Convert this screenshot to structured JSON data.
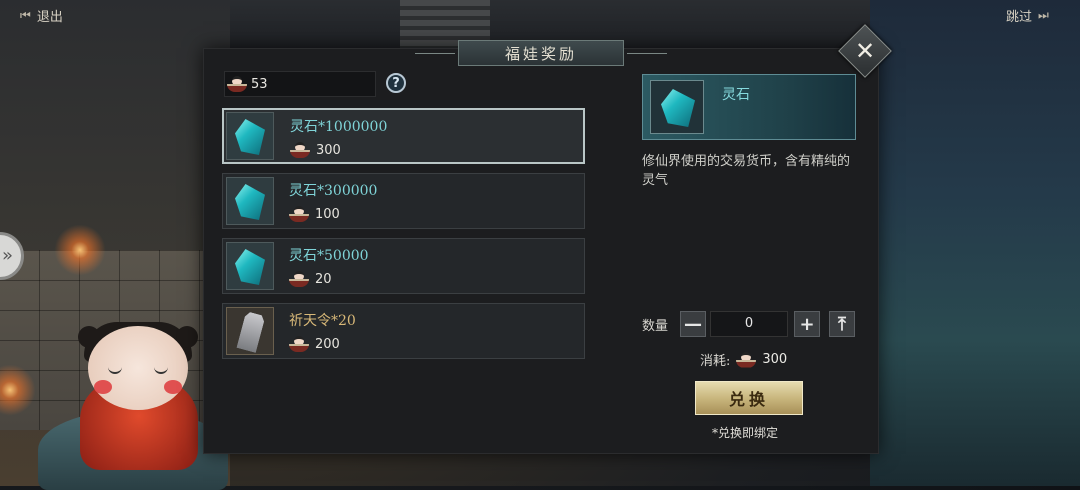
{
  "top_bar": {
    "exit_label": "退出",
    "skip_label": "跳过"
  },
  "panel": {
    "title": "福娃奖励"
  },
  "currency": {
    "amount": "53",
    "icon": "fuwa-doll-icon"
  },
  "items": [
    {
      "name": "灵石*1000000",
      "price": "300",
      "icon": "spirit-stone-icon",
      "selected": true
    },
    {
      "name": "灵石*300000",
      "price": "100",
      "icon": "spirit-stone-icon",
      "selected": false
    },
    {
      "name": "灵石*50000",
      "price": "20",
      "icon": "spirit-stone-icon",
      "selected": false
    },
    {
      "name": "祈天令*20",
      "price": "200",
      "icon": "prayer-token-icon",
      "selected": false
    }
  ],
  "detail": {
    "name": "灵石",
    "description": "修仙界使用的交易货币，含有精纯的灵气",
    "quantity_label": "数量",
    "quantity_value": "0",
    "cost_label": "消耗:",
    "cost_value": "300",
    "exchange_label": "兑换",
    "bind_note": "*兑换即绑定"
  },
  "colors": {
    "item_name": "#7fd4d8",
    "token_name": "#d8b878",
    "exchange_button": "#c9b77e"
  }
}
